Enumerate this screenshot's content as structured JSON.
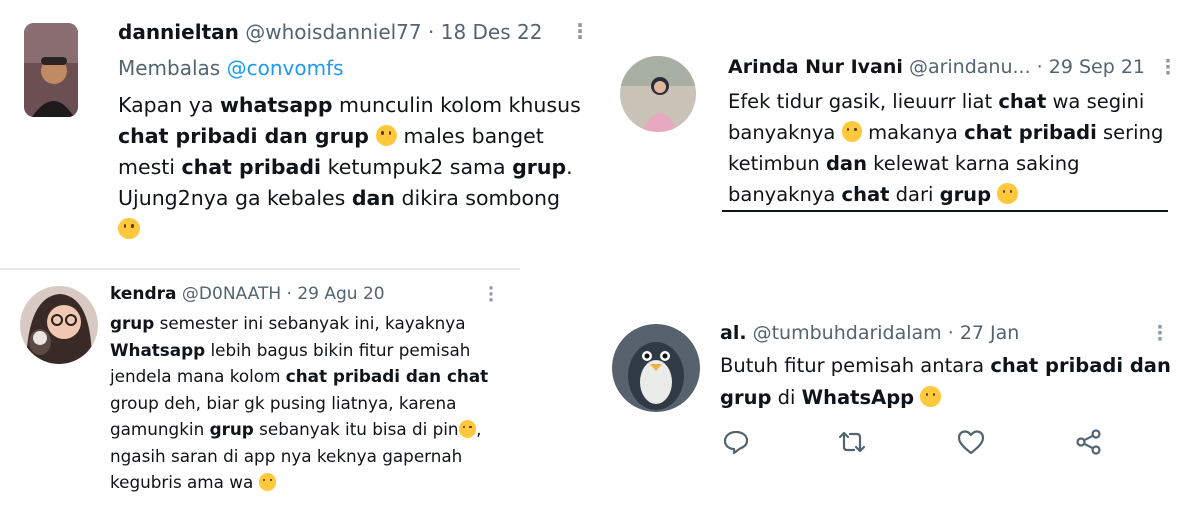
{
  "tweets": [
    {
      "name": "dannieltan",
      "handle": "@whoisdanniel77",
      "sep": " · ",
      "date": "18 Des 22",
      "reply_prefix": "Membalas ",
      "reply_handle": "@convomfs",
      "lines": [
        [
          "Kapan ya ",
          "**whatsapp**",
          " munculin kolom khusus"
        ],
        [
          "**chat pribadi dan grup**",
          " ",
          "::emoji",
          " males banget"
        ],
        [
          "mesti ",
          "**chat pribadi**",
          " ketumpuk2 sama ",
          "**grup**",
          "."
        ],
        [
          "Ujung2nya ga kebales ",
          "**dan**",
          " dikira sombong"
        ],
        [
          "::emoji"
        ]
      ]
    },
    {
      "name": "Arinda Nur Ivani",
      "handle": "@arindanu...",
      "sep": " · ",
      "date": "29 Sep 21",
      "lines": [
        [
          "Efek tidur gasik, lieuurr liat ",
          "**chat**",
          " wa segini"
        ],
        [
          "banyaknya ",
          "::emoji",
          " makanya ",
          "**chat pribadi**",
          " sering"
        ],
        [
          "ketimbun ",
          "**dan**",
          " kelewat karna saking"
        ],
        [
          "banyaknya ",
          "**chat**",
          " dari ",
          "**grup**",
          " ",
          "::emoji"
        ]
      ]
    },
    {
      "name": "kendra",
      "handle": "@D0NAATH",
      "sep": " · ",
      "date": "29 Agu 20",
      "lines": [
        [
          "**grup**",
          " semester ini sebanyak ini, kayaknya"
        ],
        [
          "**Whatsapp**",
          " lebih bagus bikin fitur pemisah"
        ],
        [
          "jendela mana kolom ",
          "**chat pribadi dan chat**"
        ],
        [
          "group deh, biar gk pusing liatnya, karena"
        ],
        [
          "gamungkin ",
          "**grup**",
          " sebanyak itu bisa di pin",
          "::emoji",
          ","
        ],
        [
          "ngasih saran di app nya keknya gapernah"
        ],
        [
          "kegubris ama wa ",
          "::emoji"
        ]
      ]
    },
    {
      "name": "al.",
      "handle": "@tumbuhdaridalam",
      "sep": " · ",
      "date": "27 Jan",
      "lines": [
        [
          "Butuh fitur pemisah antara ",
          "**chat pribadi dan**"
        ],
        [
          "**grup**",
          " di ",
          "**WhatsApp**",
          " ",
          "::emoji"
        ]
      ]
    }
  ],
  "icons": {
    "more": "more-vertical-icon",
    "reply": "reply-icon",
    "retweet": "retweet-icon",
    "like": "heart-icon",
    "share": "share-icon",
    "emoji": "emoji-face-icon"
  },
  "colors": {
    "text": "#0f1419",
    "meta": "#536471",
    "link": "#1d9bf0",
    "icon": "#536471"
  }
}
